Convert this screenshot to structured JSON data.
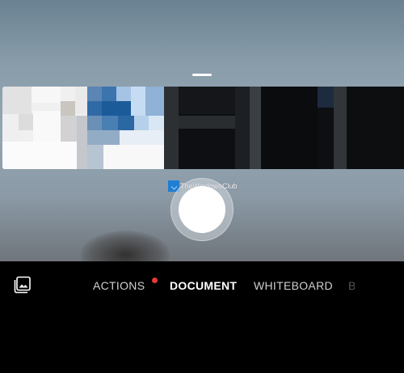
{
  "camera": {
    "watermark_text": "TheWindowsClub",
    "shutter_label": "Capture"
  },
  "toolbar": {
    "gallery_icon": "image-gallery-icon"
  },
  "modes": {
    "actions": {
      "label": "ACTIONS",
      "has_notification": true
    },
    "document": {
      "label": "DOCUMENT",
      "selected": true
    },
    "whiteboard": {
      "label": "WHITEBOARD"
    },
    "next_partial": {
      "label": "B"
    }
  },
  "colors": {
    "selected_mode": "#ffffff",
    "unselected_mode": "#cfcfcf",
    "notification_dot": "#e53935",
    "background": "#000000"
  }
}
